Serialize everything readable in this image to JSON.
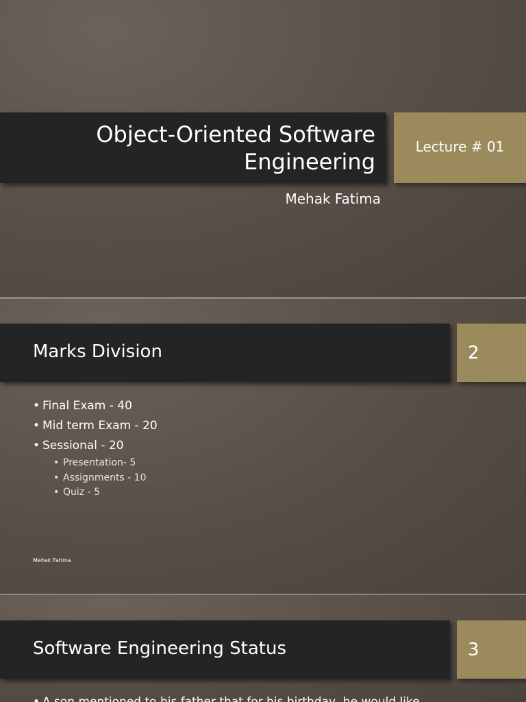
{
  "slide1": {
    "title": "Object-Oriented Software Engineering",
    "title_line1": "Object-Oriented Software",
    "title_line2": "Engineering",
    "lecture": "Lecture # 01",
    "author": "Mehak Fatima"
  },
  "slide2": {
    "title": "Marks Division",
    "number": "2",
    "bullets": [
      "Final Exam  - 40",
      "Mid term Exam - 20",
      "Sessional - 20"
    ],
    "sub_bullets": [
      "Presentation- 5",
      "Assignments - 10",
      "Quiz - 5"
    ],
    "footer": "Mehak Fatima"
  },
  "slide3": {
    "title": "Software Engineering Status",
    "number": "3",
    "bullet": "A son mentioned to his father that for his birthday, he would like"
  }
}
